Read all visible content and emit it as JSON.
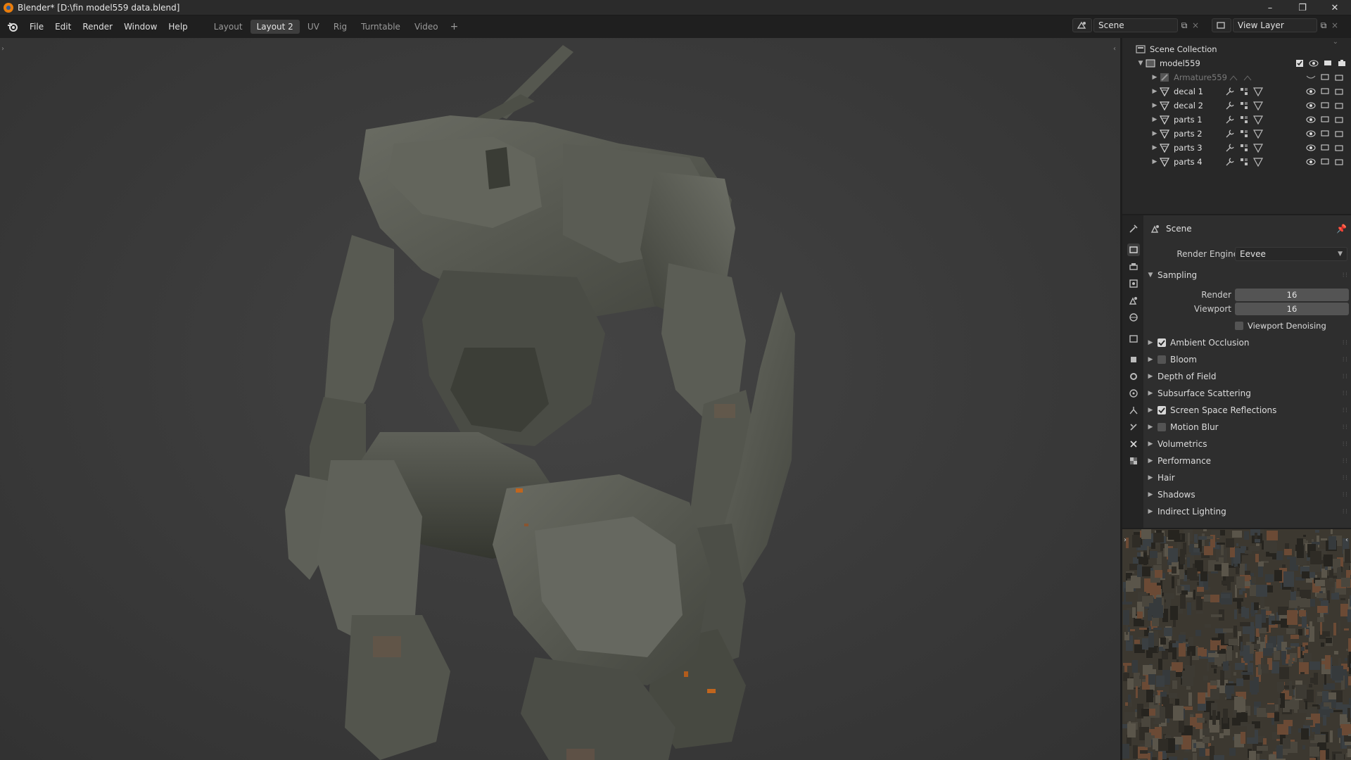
{
  "window": {
    "title": "Blender* [D:\\fin model559 data.blend]",
    "controls": [
      "–",
      "❐",
      "✕"
    ]
  },
  "menu": {
    "items": [
      "File",
      "Edit",
      "Render",
      "Window",
      "Help"
    ]
  },
  "workspaces": {
    "tabs": [
      "Layout",
      "Layout 2",
      "UV",
      "Rig",
      "Turntable",
      "Video"
    ],
    "active": "Layout 2",
    "add": "+"
  },
  "scene_selector": {
    "value": "Scene"
  },
  "view_layer_selector": {
    "value": "View Layer"
  },
  "outliner": {
    "root": "Scene Collection",
    "collection": "model559",
    "items": [
      {
        "name": "Armature559",
        "type": "armature",
        "dim": true
      },
      {
        "name": "decal 1",
        "type": "mesh"
      },
      {
        "name": "decal 2",
        "type": "mesh"
      },
      {
        "name": "parts 1",
        "type": "mesh"
      },
      {
        "name": "parts 2",
        "type": "mesh"
      },
      {
        "name": "parts 3",
        "type": "mesh"
      },
      {
        "name": "parts 4",
        "type": "mesh"
      }
    ]
  },
  "properties": {
    "context": "Scene",
    "render_engine_label": "Render Engine",
    "render_engine_value": "Eevee",
    "sampling": {
      "title": "Sampling",
      "render_label": "Render",
      "render_value": "16",
      "viewport_label": "Viewport",
      "viewport_value": "16",
      "denoise_label": "Viewport Denoising"
    },
    "sections": [
      {
        "label": "Ambient Occlusion",
        "checkbox": true,
        "checked": true
      },
      {
        "label": "Bloom",
        "checkbox": true,
        "checked": false
      },
      {
        "label": "Depth of Field",
        "checkbox": false
      },
      {
        "label": "Subsurface Scattering",
        "checkbox": false
      },
      {
        "label": "Screen Space Reflections",
        "checkbox": true,
        "checked": true
      },
      {
        "label": "Motion Blur",
        "checkbox": true,
        "checked": false
      },
      {
        "label": "Volumetrics",
        "checkbox": false
      },
      {
        "label": "Performance",
        "checkbox": false
      },
      {
        "label": "Hair",
        "checkbox": false
      },
      {
        "label": "Shadows",
        "checkbox": false
      },
      {
        "label": "Indirect Lighting",
        "checkbox": false
      }
    ]
  },
  "colors": {
    "accent": "#e87d0d",
    "viewport_bg": "#3b3b3b",
    "robot": "#5c5e55"
  }
}
